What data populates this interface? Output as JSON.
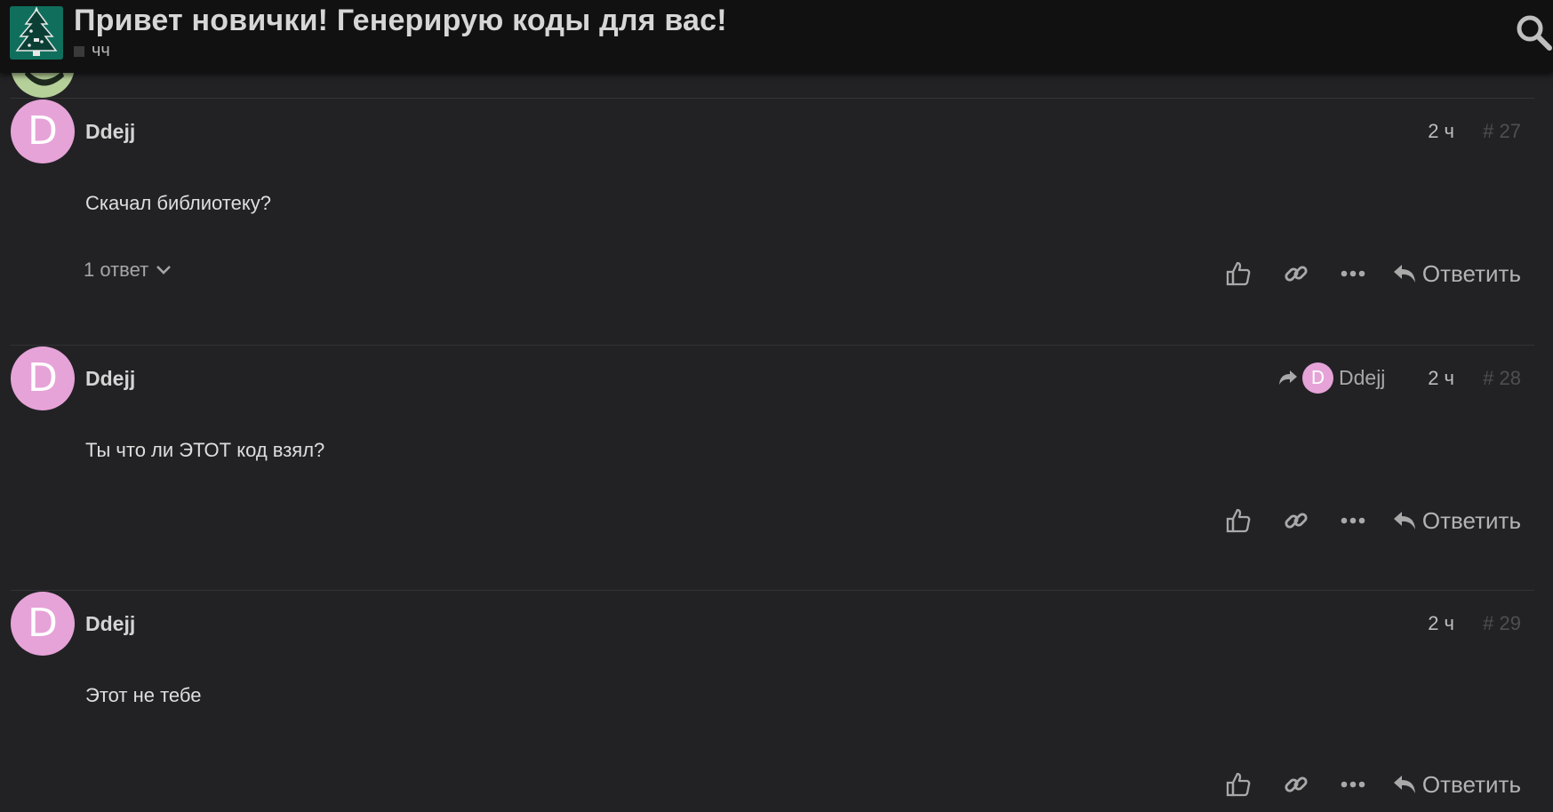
{
  "header": {
    "title": "Привет новички! Генерирую коды для вас!",
    "category": "чч"
  },
  "posts": [
    {
      "username": "Ddejj",
      "avatar_letter": "D",
      "time": "2 ч",
      "number": "# 27",
      "body": "Скачал библиотеку?",
      "replies_label": "1 ответ",
      "reply_label": "Ответить"
    },
    {
      "username": "Ddejj",
      "avatar_letter": "D",
      "reply_to_user": "Ddejj",
      "reply_to_letter": "D",
      "time": "2 ч",
      "number": "# 28",
      "body": "Ты что ли ЭТОТ код взял?",
      "reply_label": "Ответить"
    },
    {
      "username": "Ddejj",
      "avatar_letter": "D",
      "time": "2 ч",
      "number": "# 29",
      "body": "Этот не тебе",
      "reply_label": "Ответить"
    }
  ],
  "colors": {
    "background": "#222224",
    "header": "#111112",
    "avatar": "#e6a3d8",
    "logo": "#0f6f5c"
  },
  "icons": [
    "search-icon",
    "like-icon",
    "link-icon",
    "more-icon",
    "reply-icon",
    "chevron-down-icon",
    "reply-to-arrow-icon"
  ]
}
